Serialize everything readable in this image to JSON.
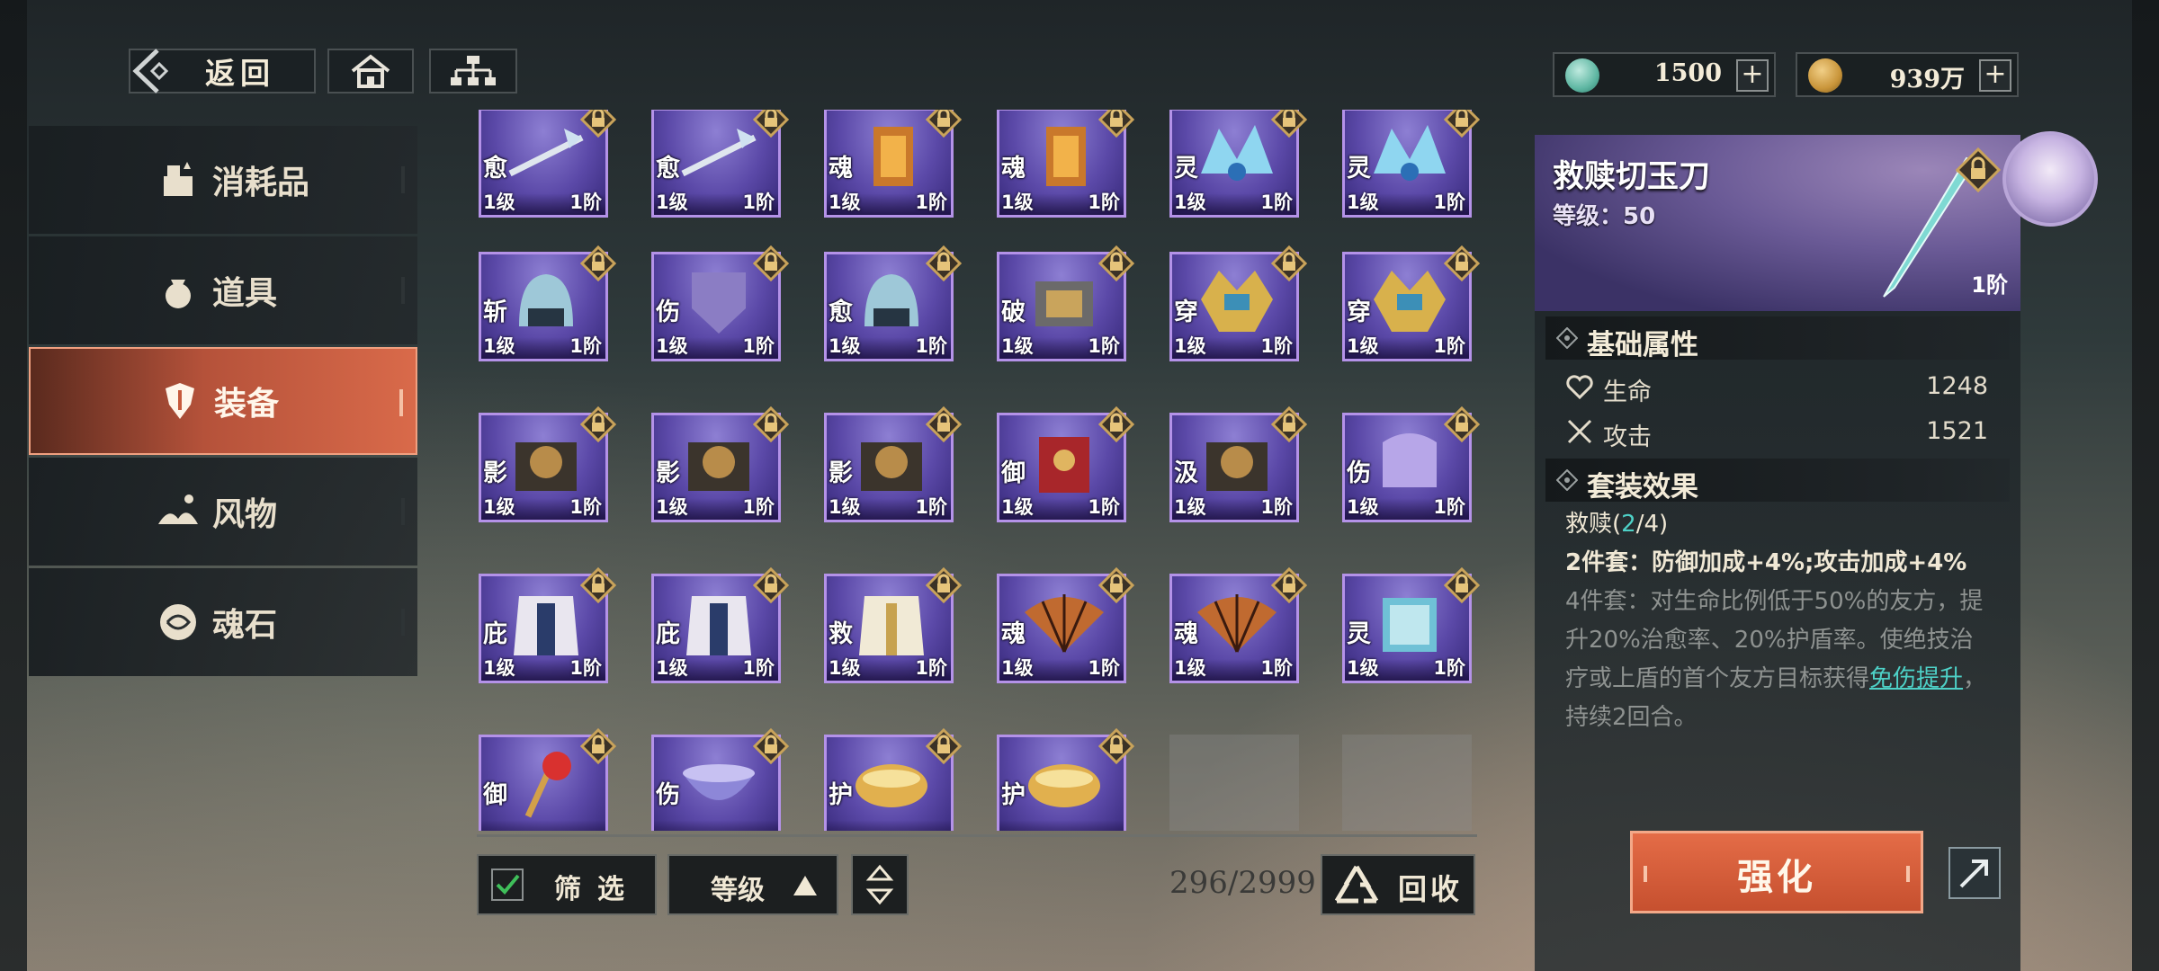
{
  "header": {
    "back_label": "返回",
    "currency": [
      {
        "value": "1500",
        "icon": "jade-coin-icon",
        "color": "#5fb7a3"
      },
      {
        "value": "939万",
        "icon": "gold-coin-icon",
        "color": "#c9953a"
      }
    ]
  },
  "sidebar": {
    "items": [
      {
        "label": "消耗品",
        "icon": "consumable-icon",
        "active": false
      },
      {
        "label": "道具",
        "icon": "item-bag-icon",
        "active": false
      },
      {
        "label": "装备",
        "icon": "equipment-icon",
        "active": true
      },
      {
        "label": "风物",
        "icon": "scenery-icon",
        "active": false
      },
      {
        "label": "魂石",
        "icon": "soul-stone-icon",
        "active": false
      }
    ]
  },
  "inventory": {
    "items": [
      {
        "tag": "愈",
        "level": "1级",
        "rank": "1阶",
        "kind": "spear"
      },
      {
        "tag": "愈",
        "level": "1级",
        "rank": "1阶",
        "kind": "spear"
      },
      {
        "tag": "魂",
        "level": "1级",
        "rank": "1阶",
        "kind": "lantern"
      },
      {
        "tag": "魂",
        "level": "1级",
        "rank": "1阶",
        "kind": "lantern"
      },
      {
        "tag": "灵",
        "level": "1级",
        "rank": "1阶",
        "kind": "crown"
      },
      {
        "tag": "灵",
        "level": "1级",
        "rank": "1阶",
        "kind": "crown"
      },
      {
        "tag": "斩",
        "level": "1级",
        "rank": "1阶",
        "kind": "helm"
      },
      {
        "tag": "伤",
        "level": "1级",
        "rank": "1阶",
        "kind": "shield"
      },
      {
        "tag": "愈",
        "level": "1级",
        "rank": "1阶",
        "kind": "helm"
      },
      {
        "tag": "破",
        "level": "1级",
        "rank": "1阶",
        "kind": "armor"
      },
      {
        "tag": "穿",
        "level": "1级",
        "rank": "1阶",
        "kind": "gold"
      },
      {
        "tag": "穿",
        "level": "1级",
        "rank": "1阶",
        "kind": "gold"
      },
      {
        "tag": "影",
        "level": "1级",
        "rank": "1阶",
        "kind": "dark"
      },
      {
        "tag": "影",
        "level": "1级",
        "rank": "1阶",
        "kind": "dark"
      },
      {
        "tag": "影",
        "level": "1级",
        "rank": "1阶",
        "kind": "dark"
      },
      {
        "tag": "御",
        "level": "1级",
        "rank": "1阶",
        "kind": "red"
      },
      {
        "tag": "汲",
        "level": "1级",
        "rank": "1阶",
        "kind": "dark"
      },
      {
        "tag": "伤",
        "level": "1级",
        "rank": "1阶",
        "kind": "purple"
      },
      {
        "tag": "庇",
        "level": "1级",
        "rank": "1阶",
        "kind": "robe"
      },
      {
        "tag": "庇",
        "level": "1级",
        "rank": "1阶",
        "kind": "robe"
      },
      {
        "tag": "救",
        "level": "1级",
        "rank": "1阶",
        "kind": "white"
      },
      {
        "tag": "魂",
        "level": "1级",
        "rank": "1阶",
        "kind": "fan"
      },
      {
        "tag": "魂",
        "level": "1级",
        "rank": "1阶",
        "kind": "fan"
      },
      {
        "tag": "灵",
        "level": "1级",
        "rank": "1阶",
        "kind": "book"
      },
      {
        "tag": "御",
        "level": "",
        "rank": "",
        "kind": "staff"
      },
      {
        "tag": "伤",
        "level": "",
        "rank": "",
        "kind": "bowl"
      },
      {
        "tag": "护",
        "level": "",
        "rank": "",
        "kind": "pot"
      },
      {
        "tag": "护",
        "level": "",
        "rank": "",
        "kind": "pot"
      },
      {
        "empty": true
      },
      {
        "empty": true
      }
    ]
  },
  "controls": {
    "filter_label": "筛选",
    "sort_label": "等级",
    "count": "296/2999",
    "recycle_label": "回收"
  },
  "detail": {
    "name": "救赎切玉刀",
    "level_text": "等级：50",
    "rank": "1阶",
    "base_header": "基础属性",
    "attrs": [
      {
        "name": "生命",
        "value": "1248",
        "icon": "heart-icon"
      },
      {
        "name": "攻击",
        "value": "1521",
        "icon": "swords-icon"
      }
    ],
    "set_header": "套装效果",
    "set_name_prefix": "救赎(",
    "set_count": "2",
    "set_name_suffix": "/4)",
    "set2": "2件套：防御加成+4%;攻击加成+4%",
    "set4_before": "4件套：对生命比例低于50%的友方，提升20%治愈率、20%护盾率。使绝技治疗或上盾的首个友方目标获得",
    "set4_link": "免伤提升",
    "set4_after": "，持续2回合。",
    "enhance_label": "强化"
  }
}
